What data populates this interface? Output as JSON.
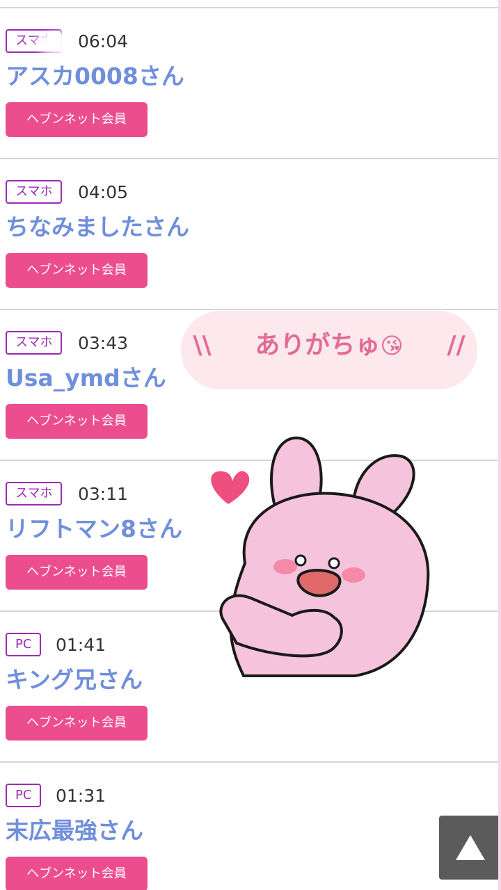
{
  "visitors": [
    {
      "device": "スマホ",
      "time": "06:04",
      "name": "アスカ0008さん",
      "member_label": "ヘブンネット会員"
    },
    {
      "device": "スマホ",
      "time": "04:05",
      "name": "ちなみましたさん",
      "member_label": "ヘブンネット会員"
    },
    {
      "device": "スマホ",
      "time": "03:43",
      "name": "Usa_ymdさん",
      "member_label": "ヘブンネット会員"
    },
    {
      "device": "スマホ",
      "time": "03:11",
      "name": "リフトマン8さん",
      "member_label": "ヘブンネット会員"
    },
    {
      "device": "PC",
      "time": "01:41",
      "name": "キング兄さん",
      "member_label": "ヘブンネット会員"
    },
    {
      "device": "PC",
      "time": "01:31",
      "name": "末広最強さん",
      "member_label": "ヘブンネット会員"
    }
  ],
  "sticker": {
    "left_mark": "\\\\",
    "text": "ありがちゅ",
    "emoji": "😘",
    "right_mark": "//"
  },
  "scroll_top": {
    "icon": "triangle-up-icon"
  },
  "colors": {
    "accent_pink": "#ec4d8f",
    "badge_purple": "#9b2bb3",
    "name_blue": "#6f8fdc",
    "bubble_bg": "#fde8ee",
    "bubble_text": "#e26b92",
    "scroll_button": "#5b5b5b"
  }
}
